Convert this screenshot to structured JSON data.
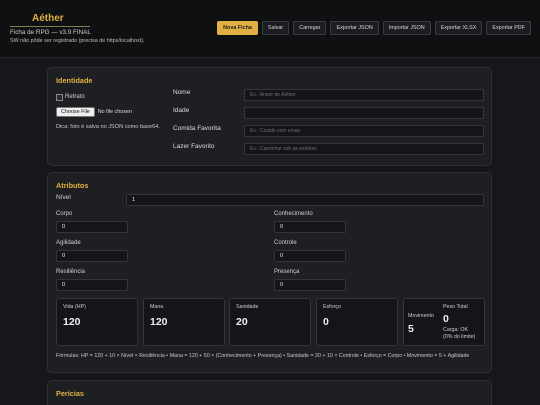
{
  "header": {
    "title": "Aéther",
    "subtitle": "Ficha de RPG — v3.9 FINAL",
    "note": "SW não pôde ser registrado (precisa de https/localhost).",
    "buttons": [
      "Nova Ficha",
      "Salvar",
      "Carregar",
      "Exportar JSON",
      "Importar JSON",
      "Exportar XLSX",
      "Exportar PDF"
    ]
  },
  "identity": {
    "title": "Identidade",
    "portrait_alt": "Retrato",
    "file_button": "Choose File",
    "file_status": "No file chosen",
    "tip": "Dica: foto é salva no JSON como base64.",
    "fields": [
      {
        "label": "Nome",
        "placeholder": "Ex.: Aranir de Aéther"
      },
      {
        "label": "Idade",
        "placeholder": ""
      },
      {
        "label": "Comida Favorita",
        "placeholder": "Ex.: Cozido com ervas"
      },
      {
        "label": "Lazer Favorito",
        "placeholder": "Ex.: Caminhar sob as estrelas"
      }
    ]
  },
  "attributes": {
    "title": "Atributos",
    "nivel_label": "Nível",
    "nivel_value": "1",
    "fields": [
      {
        "label": "Corpo",
        "value": "0"
      },
      {
        "label": "Conhecimento",
        "value": "0"
      },
      {
        "label": "Agilidade",
        "value": "0"
      },
      {
        "label": "Controle",
        "value": "0"
      },
      {
        "label": "Resiliência",
        "value": "0"
      },
      {
        "label": "Presença",
        "value": "0"
      }
    ],
    "stats": [
      {
        "label": "Vida (HP)",
        "value": "120"
      },
      {
        "label": "Mana",
        "value": "120"
      },
      {
        "label": "Sanidade",
        "value": "20"
      },
      {
        "label": "Esforço",
        "value": "0"
      }
    ],
    "movement": {
      "label": "Movimento",
      "value": "5"
    },
    "weight": {
      "label": "Peso Total",
      "value": "0",
      "load": "Carga: OK",
      "limit": "(0% do limite)"
    },
    "formula": "Fórmulas: HP = 120 + 10 × Nível × Resiliência • Mana = 120 + 50 × (Conhecimento + Presença) • Sanidade = 20 + 10 × Controle • Esforço = Corpo • Movimento = 5 + Agilidade"
  },
  "skills": {
    "title": "Perícias"
  }
}
